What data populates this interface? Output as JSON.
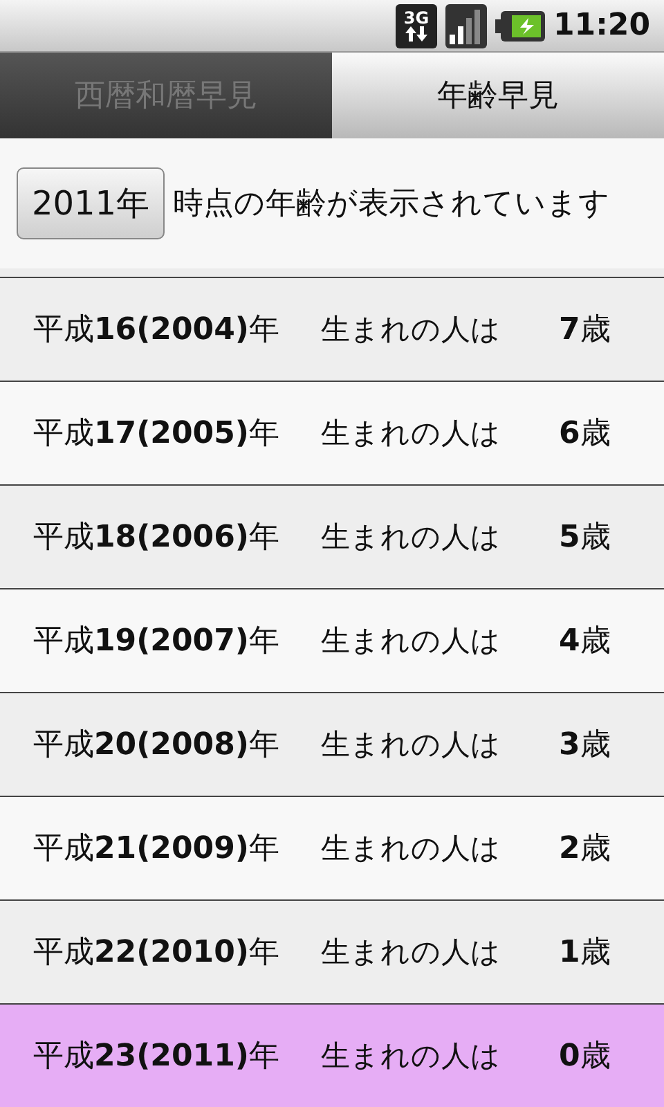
{
  "status_bar": {
    "network": "3G",
    "time": "11:20"
  },
  "tabs": [
    {
      "label": "西暦和暦早見",
      "selected": false
    },
    {
      "label": "年齢早見",
      "selected": true
    }
  ],
  "header": {
    "year_button": "2011年",
    "caption": "時点の年齢が表示されています"
  },
  "rows": [
    {
      "era": "平成**16(2004)**年",
      "born": "生まれの人は",
      "age": "**7**歳",
      "highlighted": false
    },
    {
      "era": "平成**17(2005)**年",
      "born": "生まれの人は",
      "age": "**6**歳",
      "highlighted": false
    },
    {
      "era": "平成**18(2006)**年",
      "born": "生まれの人は",
      "age": "**5**歳",
      "highlighted": false
    },
    {
      "era": "平成**19(2007)**年",
      "born": "生まれの人は",
      "age": "**4**歳",
      "highlighted": false
    },
    {
      "era": "平成**20(2008)**年",
      "born": "生まれの人は",
      "age": "**3**歳",
      "highlighted": false
    },
    {
      "era": "平成**21(2009)**年",
      "born": "生まれの人は",
      "age": "**2**歳",
      "highlighted": false
    },
    {
      "era": "平成**22(2010)**年",
      "born": "生まれの人は",
      "age": "**1**歳",
      "highlighted": false
    },
    {
      "era": "平成**23(2011)**年",
      "born": "生まれの人は",
      "age": "**0**歳",
      "highlighted": true
    }
  ]
}
